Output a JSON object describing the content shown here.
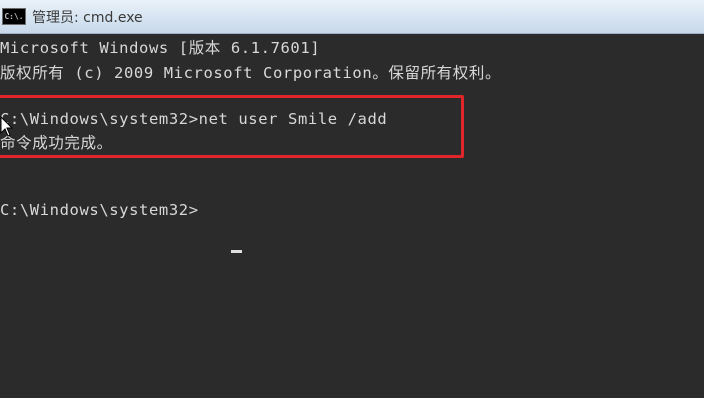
{
  "window": {
    "title": "管理员: cmd.exe",
    "icon": "cmd-icon",
    "icon_text": "C:\\."
  },
  "console": {
    "lines": [
      "Microsoft Windows [版本 6.1.7601]",
      "版权所有 (c) 2009 Microsoft Corporation。保留所有权利。",
      "C:\\Windows\\system32>net user Smile /add",
      "命令成功完成。",
      "C:\\Windows\\system32>"
    ],
    "highlight_color": "#e0252b",
    "text_color": "#d8d8d8",
    "background_color": "#2b2b2b"
  }
}
